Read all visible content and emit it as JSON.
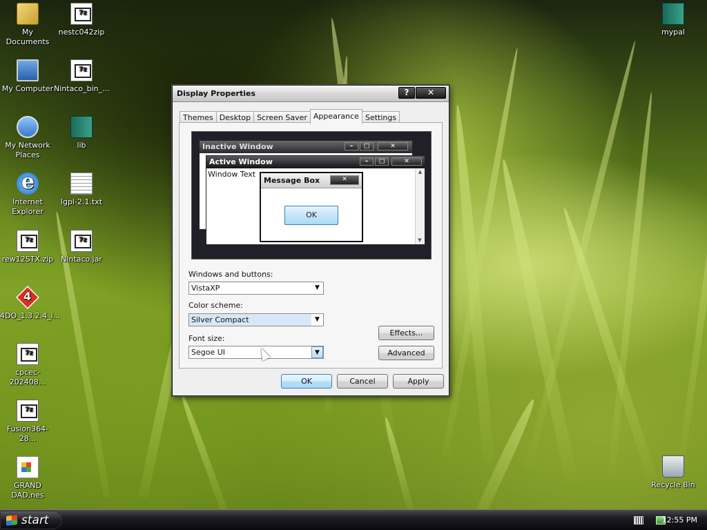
{
  "desktop": {
    "icons": [
      {
        "label": "My Documents",
        "icon": "folder-icon"
      },
      {
        "label": "nestc042zip",
        "icon": "archive-7z-icon"
      },
      {
        "label": "mypal",
        "icon": "book-icon"
      },
      {
        "label": "My Computer",
        "icon": "computer-icon"
      },
      {
        "label": "Nintaco_bin_...",
        "icon": "archive-7z-icon"
      },
      {
        "label": "My Network Places",
        "icon": "network-icon"
      },
      {
        "label": "lib",
        "icon": "book-icon"
      },
      {
        "label": "Internet Explorer",
        "icon": "internet-explorer-icon"
      },
      {
        "label": "lgpl-2.1.txt",
        "icon": "text-file-icon"
      },
      {
        "label": "rew12STX.zip",
        "icon": "archive-7z-icon"
      },
      {
        "label": "Nintaco.jar",
        "icon": "archive-7z-icon"
      },
      {
        "label": "4DO_1.3.2.4_l...",
        "icon": "4do-app-icon"
      },
      {
        "label": "cpcec-202408...",
        "icon": "archive-7z-icon"
      },
      {
        "label": "Fusion364-28...",
        "icon": "archive-7z-icon"
      },
      {
        "label": "GRAND DAD.nes",
        "icon": "nes-rom-icon"
      },
      {
        "label": "Recycle Bin",
        "icon": "recycle-bin-icon"
      }
    ]
  },
  "dialog": {
    "title": "Display Properties",
    "help_glyph": "?",
    "close_glyph": "✕",
    "tabs": [
      "Themes",
      "Desktop",
      "Screen Saver",
      "Appearance",
      "Settings"
    ],
    "active_tab": "Appearance",
    "preview": {
      "inactive_title": "Inactive Window",
      "active_title": "Active Window",
      "window_text": "Window Text",
      "message_title": "Message Box",
      "message_ok": "OK"
    },
    "windows_buttons_label": "Windows and buttons:",
    "windows_buttons_value": "VistaXP",
    "color_scheme_label": "Color scheme:",
    "color_scheme_value": "Silver Compact",
    "font_size_label": "Font size:",
    "font_size_value": "Segoe UI",
    "effects_label": "Effects...",
    "advanced_label": "Advanced",
    "ok_label": "OK",
    "cancel_label": "Cancel",
    "apply_label": "Apply"
  },
  "taskbar": {
    "start_label": "start",
    "clock": "12:55 PM"
  }
}
